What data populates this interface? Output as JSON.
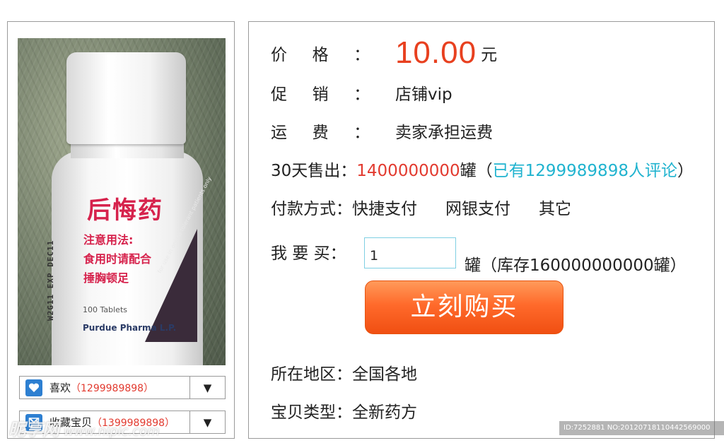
{
  "product_image": {
    "title": "后悔药",
    "usage_lines": [
      "注意用法:",
      "食用时请配合",
      "捶胸顿足"
    ],
    "side_code": "W2G11 EXP DEC11",
    "tablets": "100 Tablets",
    "maker": "Purdue Pharma L.P.",
    "triangle_text": "for use in opioid tolerant patients only"
  },
  "actions": {
    "like": {
      "label": "喜欢",
      "count": "（1299989898）",
      "icon": "heart-icon"
    },
    "favorite": {
      "label": "收藏宝贝",
      "count": "（1399989898）",
      "icon": "bookmark-icon"
    },
    "dropdown_glyph": "▼"
  },
  "details": {
    "price_label": "价格：",
    "price_value": "10.00",
    "price_unit": "元",
    "promo_label": "促销：",
    "promo_value": "店铺vip",
    "shipping_label": "运费：",
    "shipping_value": "卖家承担运费",
    "sold_label": "30天售出：",
    "sold_value": "1400000000",
    "sold_unit": "罐",
    "reviews_open": "（",
    "reviews_text": "已有1299989898人评论",
    "reviews_close": "）",
    "payment_label": "付款方式：",
    "payment_options": [
      "快捷支付",
      "网银支付",
      "其它"
    ],
    "buy_label": "我 要 买：",
    "quantity": "1",
    "stock_text": "罐（库存160000000000罐）",
    "buy_button": "立刻购买",
    "region_label": "所在地区：",
    "region_value": "全国各地",
    "type_label": "宝贝类型：",
    "type_value": "全新药方"
  },
  "watermark": {
    "site": "昵享网",
    "url": "www.nipic.com",
    "id_text": "ID:7252881 NO:20120718110442569000"
  },
  "colors": {
    "price": "#e8401f",
    "highlight_red": "#e23a2f",
    "review_teal": "#20b3cf",
    "button_orange": "#ff6a2b",
    "icon_blue": "#2d7fd1"
  }
}
